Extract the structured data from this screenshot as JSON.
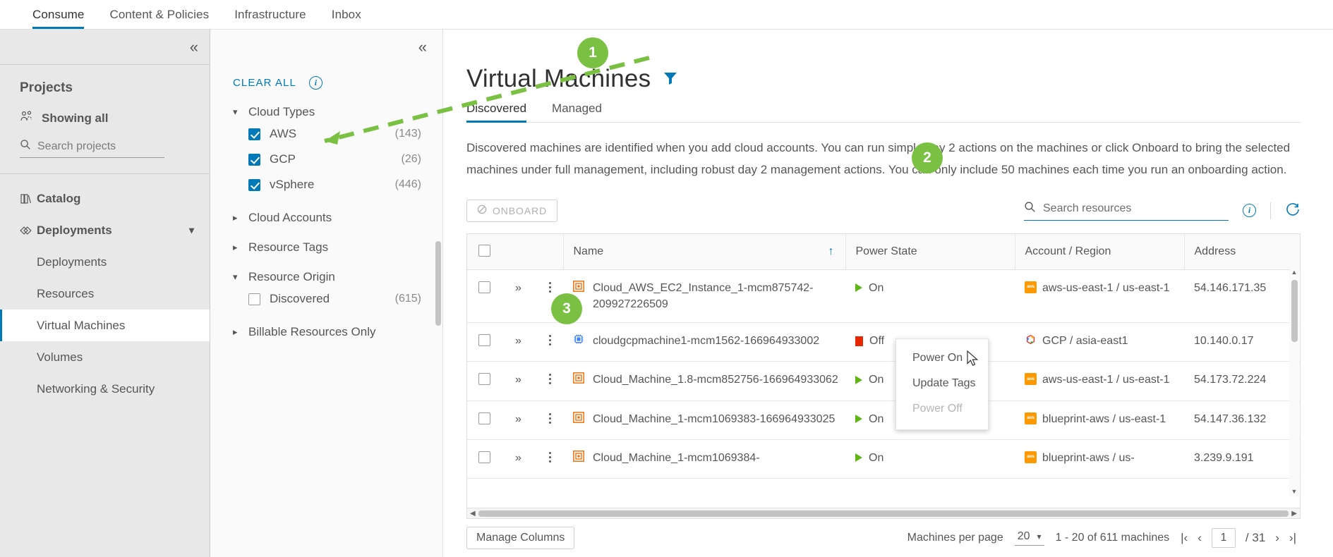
{
  "topnav": {
    "items": [
      {
        "label": "Consume",
        "active": true
      },
      {
        "label": "Content & Policies",
        "active": false
      },
      {
        "label": "Infrastructure",
        "active": false
      },
      {
        "label": "Inbox",
        "active": false
      }
    ]
  },
  "left_panel": {
    "collapse_icon": "chevron-double-left-icon",
    "projects_title": "Projects",
    "showing_all": "Showing all",
    "showing_all_icon": "users-group-icon",
    "search_placeholder": "Search projects",
    "search_value": "",
    "search_icon": "search-icon",
    "nav": [
      {
        "label": "Catalog",
        "icon": "catalog-icon",
        "level": "top",
        "selected": false,
        "expandable": false
      },
      {
        "label": "Deployments",
        "icon": "deployments-icon",
        "level": "top",
        "selected": false,
        "expandable": true,
        "expanded": true
      },
      {
        "label": "Deployments",
        "icon": "",
        "level": "sub",
        "selected": false,
        "expandable": false
      },
      {
        "label": "Resources",
        "icon": "",
        "level": "sub",
        "selected": false,
        "expandable": false
      },
      {
        "label": "Virtual Machines",
        "icon": "",
        "level": "sub",
        "selected": true,
        "expandable": false
      },
      {
        "label": "Volumes",
        "icon": "",
        "level": "sub",
        "selected": false,
        "expandable": false
      },
      {
        "label": "Networking & Security",
        "icon": "",
        "level": "sub",
        "selected": false,
        "expandable": false
      }
    ]
  },
  "filter_panel": {
    "collapse_icon": "chevron-double-left-icon",
    "clear_all": "CLEAR ALL",
    "info_icon": "info-circle-icon",
    "groups": [
      {
        "title": "Cloud Types",
        "expanded": true,
        "options": [
          {
            "label": "AWS",
            "count": "(143)",
            "checked": true
          },
          {
            "label": "GCP",
            "count": "(26)",
            "checked": true
          },
          {
            "label": "vSphere",
            "count": "(446)",
            "checked": true
          }
        ]
      },
      {
        "title": "Cloud Accounts",
        "expanded": false,
        "options": []
      },
      {
        "title": "Resource Tags",
        "expanded": false,
        "options": []
      },
      {
        "title": "Resource Origin",
        "expanded": true,
        "options": [
          {
            "label": "Discovered",
            "count": "(615)",
            "checked": false
          }
        ]
      },
      {
        "title": "Billable Resources Only",
        "expanded": false,
        "options": []
      }
    ]
  },
  "main": {
    "title": "Virtual Machines",
    "filter_icon": "funnel-filter-icon",
    "tabs": [
      {
        "label": "Discovered",
        "active": true
      },
      {
        "label": "Managed",
        "active": false
      }
    ],
    "description": "Discovered machines are identified when you add cloud accounts. You can run simple day 2 actions on the machines or click Onboard to bring the selected machines under full management, including robust day 2 management actions. You can only include 50 machines each time you run an onboarding action.",
    "toolbar": {
      "onboard_label": "ONBOARD",
      "onboard_icon": "ban-circle-icon",
      "onboard_disabled": true,
      "search_placeholder": "Search resources",
      "search_value": "",
      "search_icon": "search-icon",
      "info_icon": "info-circle-icon",
      "refresh_icon": "refresh-icon"
    },
    "table": {
      "columns": [
        "Name",
        "Power State",
        "Account / Region",
        "Address"
      ],
      "sort_column": "Name",
      "sort_direction": "asc",
      "sort_icon": "arrow-up-icon",
      "rows": [
        {
          "name": "Cloud_AWS_EC2_Instance_1-mcm875742-209927226509",
          "icon": "aws-ec2-instance-icon",
          "power_state": "On",
          "power_icon": "play-triangle-icon",
          "account": "aws-us-east-1 / us-east-1",
          "account_icon": "aws-icon",
          "address": "54.146.171.35",
          "checked": false
        },
        {
          "name": "cloudgcpmachine1-mcm1562-166964933002",
          "icon": "gcp-machine-icon",
          "power_state": "Off",
          "power_icon": "stop-square-icon",
          "account": "GCP / asia-east1",
          "account_icon": "gcp-icon",
          "address": "10.140.0.17",
          "checked": false
        },
        {
          "name": "Cloud_Machine_1.8-mcm852756-166964933062",
          "icon": "aws-ec2-instance-icon",
          "power_state": "On",
          "power_icon": "play-triangle-icon",
          "account": "aws-us-east-1 / us-east-1",
          "account_icon": "aws-icon",
          "address": "54.173.72.224",
          "checked": false
        },
        {
          "name": "Cloud_Machine_1-mcm1069383-166964933025",
          "icon": "aws-ec2-instance-icon",
          "power_state": "On",
          "power_icon": "play-triangle-icon",
          "account": "blueprint-aws / us-east-1",
          "account_icon": "aws-icon",
          "address": "54.147.36.132",
          "checked": false
        },
        {
          "name": "Cloud_Machine_1-mcm1069384-",
          "icon": "aws-ec2-instance-icon",
          "power_state": "On",
          "power_icon": "play-triangle-icon",
          "account": "blueprint-aws / us-",
          "account_icon": "aws-icon",
          "address": "3.239.9.191",
          "checked": false
        }
      ]
    },
    "context_menu": {
      "items": [
        {
          "label": "Power On",
          "disabled": false
        },
        {
          "label": "Update Tags",
          "disabled": false
        },
        {
          "label": "Power Off",
          "disabled": true
        }
      ]
    },
    "footer": {
      "manage_columns": "Manage Columns",
      "per_page_label": "Machines per page",
      "per_page_value": "20",
      "range_text": "1 - 20 of 611 machines",
      "page_value": "1",
      "page_total": "/ 31",
      "first_icon": "first-page-icon",
      "prev_icon": "prev-page-icon",
      "next_icon": "next-page-icon",
      "last_icon": "last-page-icon"
    }
  },
  "annotations": {
    "badge1": "1",
    "badge2": "2",
    "badge3": "3",
    "accent_green": "#7ac143",
    "accent_blue": "#0079b8",
    "on_green": "#60b515",
    "off_red": "#e62700",
    "aws_orange": "#ff9900"
  }
}
